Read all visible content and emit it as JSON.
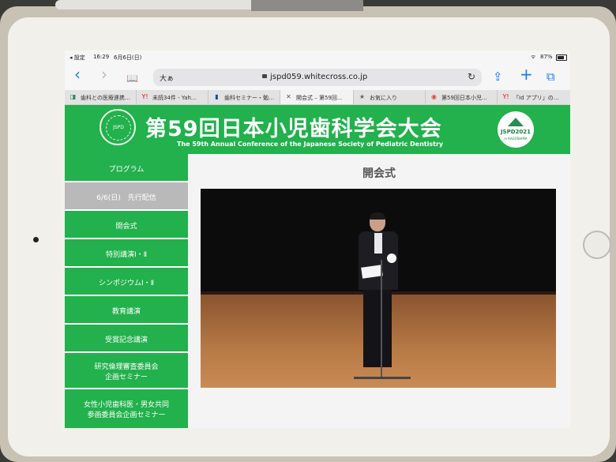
{
  "status_bar": {
    "left": "◂ 設定",
    "time": "16:29",
    "date": "6月6日(日)",
    "wifi": "ᯤ",
    "battery": "87%"
  },
  "toolbar": {
    "back": "‹",
    "forward": "›",
    "bookmarks": "📖",
    "aa": "大ぁ",
    "url": "jspd059.whitecross.co.jp",
    "reload": "↻",
    "share": "⇪",
    "add": "+",
    "tabs": "⧉"
  },
  "tabs": [
    {
      "icon": "◨",
      "label": "歯科との医療連携…"
    },
    {
      "icon": "Y!",
      "label": "未読34件 - Yah…"
    },
    {
      "icon": "▮",
      "label": "歯科セミナー・勉…"
    },
    {
      "icon": "✕",
      "label": "開会式 – 第59回…"
    },
    {
      "icon": "★",
      "label": "お気に入り"
    },
    {
      "icon": "◉",
      "label": "第59回日本小児…"
    },
    {
      "icon": "Y!",
      "label": "「Id アプリ」の…"
    }
  ],
  "banner": {
    "title": "第59回日本小児歯科学会大会",
    "subtitle": "The 59th Annual Conference of the Japanese Society of Pediatric Dentistry",
    "seal_text": "JSPD",
    "logo_text": "JSPD2021",
    "logo_sub": "in KAGOSHIMA"
  },
  "sidebar": {
    "items": [
      {
        "label": "プログラム"
      },
      {
        "label": "6/6(日)　先行配信"
      },
      {
        "label": "開会式"
      },
      {
        "label": "特別講演Ⅰ・Ⅱ"
      },
      {
        "label": "シンポジウムⅠ・Ⅱ"
      },
      {
        "label": "教育講演"
      },
      {
        "label": "受賞記念講演"
      },
      {
        "label": "研究倫理審査委員会",
        "label2": "企画セミナー"
      },
      {
        "label": "女性小児歯科医・男女共同",
        "label2": "参画委員会企画セミナー"
      }
    ]
  },
  "main": {
    "title": "開会式"
  }
}
